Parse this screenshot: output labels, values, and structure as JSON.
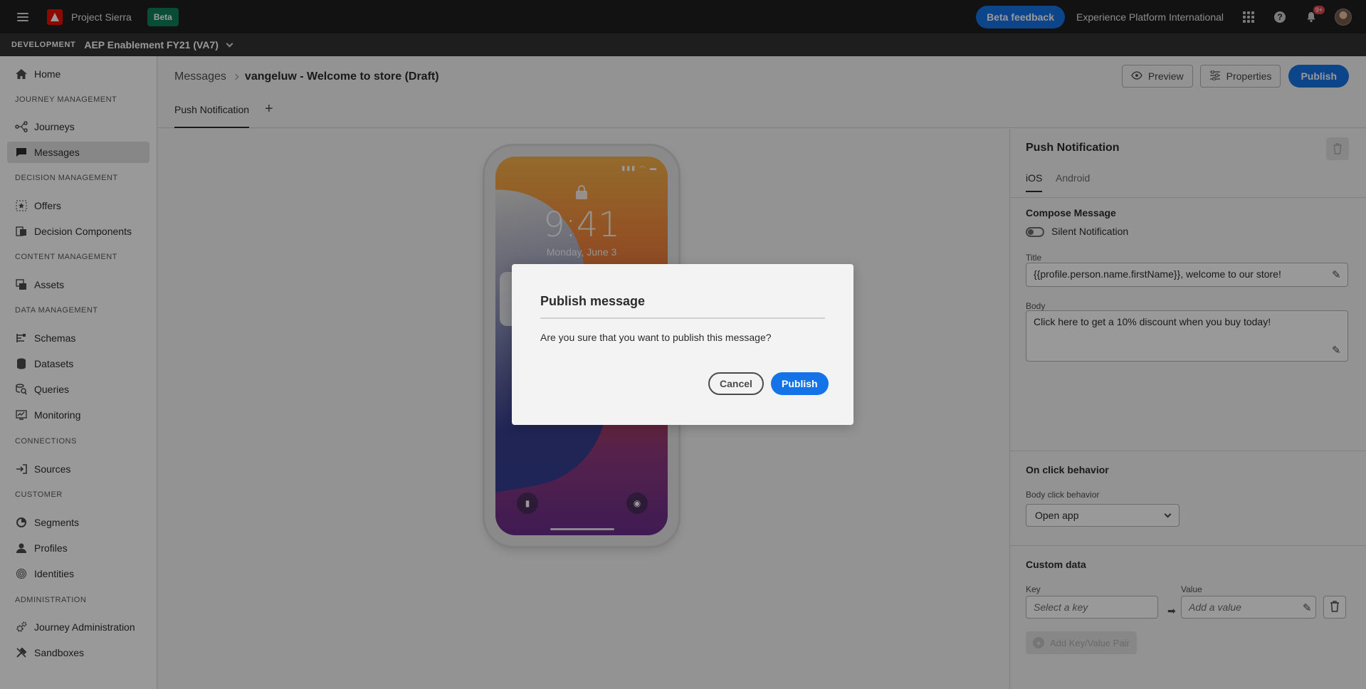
{
  "topbar": {
    "app_name": "Project Sierra",
    "beta_badge": "Beta",
    "feedback_button": "Beta feedback",
    "org_name": "Experience Platform International",
    "notification_count": "9+"
  },
  "sandbox": {
    "environment": "DEVELOPMENT",
    "name": "AEP Enablement FY21 (VA7)"
  },
  "sidebar": {
    "home": "Home",
    "sections": {
      "journey": "JOURNEY MANAGEMENT",
      "decision": "DECISION MANAGEMENT",
      "content": "CONTENT MANAGEMENT",
      "data": "DATA MANAGEMENT",
      "connections": "CONNECTIONS",
      "customer": "CUSTOMER",
      "administration": "ADMINISTRATION"
    },
    "items": {
      "journeys": "Journeys",
      "messages": "Messages",
      "offers": "Offers",
      "decision_components": "Decision Components",
      "assets": "Assets",
      "schemas": "Schemas",
      "datasets": "Datasets",
      "queries": "Queries",
      "monitoring": "Monitoring",
      "sources": "Sources",
      "segments": "Segments",
      "profiles": "Profiles",
      "identities": "Identities",
      "journey_administration": "Journey Administration",
      "sandboxes": "Sandboxes"
    },
    "active_item": "Messages"
  },
  "header": {
    "breadcrumb_parent": "Messages",
    "breadcrumb_current": "vangeluw - Welcome to store (Draft)",
    "preview_button": "Preview",
    "properties_button": "Properties",
    "publish_button": "Publish",
    "tab": "Push Notification",
    "add_tab": "+"
  },
  "phone": {
    "time": "9:41",
    "date": "Monday, June 3"
  },
  "panel": {
    "title": "Push Notification",
    "tabs": [
      "iOS",
      "Android"
    ],
    "active_tab": "iOS",
    "compose_title": "Compose Message",
    "silent_label": "Silent Notification",
    "silent_enabled": false,
    "title_label": "Title",
    "title_value": "{{profile.person.name.firstName}}, welcome to our store!",
    "body_label": "Body",
    "body_value": "Click here to get a 10% discount when you buy today!",
    "onclick_title": "On click behavior",
    "click_label": "Body click behavior",
    "click_value": "Open app",
    "custom_title": "Custom data",
    "key_label": "Key",
    "key_placeholder": "Select a key",
    "value_label": "Value",
    "value_placeholder": "Add a value",
    "add_pair": "Add Key/Value Pair"
  },
  "modal": {
    "title": "Publish message",
    "body": "Are you sure that you want to publish this message?",
    "cancel": "Cancel",
    "publish": "Publish"
  },
  "colors": {
    "accent": "#1473e6",
    "beta_badge": "#12805c",
    "topbar": "#1e1e1e",
    "adobe_red": "#eb1000"
  }
}
